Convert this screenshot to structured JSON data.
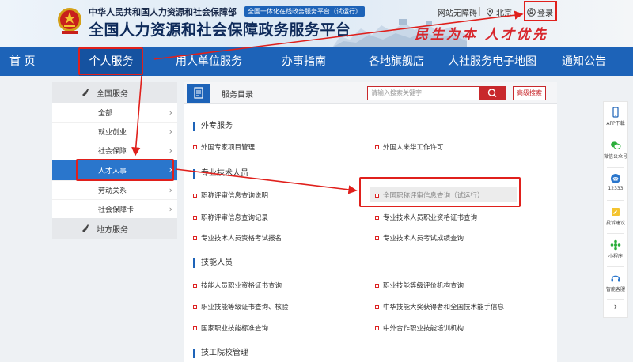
{
  "header": {
    "sub_title": "中华人民共和国人力资源和社会保障部",
    "badge": "全国一体化在线政务服务平台（试运行）",
    "main_title": "全国人力资源和社会保障政务服务平台",
    "slogan": "民生为本  人才优先",
    "accessibility": "网站无障碍",
    "location": "北京",
    "login": "登录"
  },
  "nav": {
    "items": [
      "首 页",
      "个人服务",
      "用人单位服务",
      "办事指南",
      "各地旗舰店",
      "人社服务电子地图",
      "通知公告"
    ],
    "active_index": 1
  },
  "sidebar": {
    "national_title": "全国服务",
    "items": [
      "全部",
      "就业创业",
      "社会保障",
      "人才人事",
      "劳动关系",
      "社会保障卡"
    ],
    "active_index": 3,
    "local_title": "地方服务"
  },
  "content": {
    "directory_label": "服务目录",
    "search_placeholder": "请输入搜索关键字",
    "advanced_search": "高级搜索",
    "sections": [
      {
        "title": "外专服务",
        "links": [
          "外国专家项目管理",
          "外国人来华工作许可"
        ]
      },
      {
        "title": "专业技术人员",
        "links": [
          "职称评审信息查询说明",
          "全国职称评审信息查询（试运行）",
          "职称评审信息查询记录",
          "专业技术人员职业资格证书查询",
          "专业技术人员资格考试报名",
          "专业技术人员考试成绩查询"
        ]
      },
      {
        "title": "技能人员",
        "links": [
          "技能人员职业资格证书查询",
          "职业技能等级评价机构查询",
          "职业技能等级证书查询、核验",
          "中华技能大奖获得者和全国技术能手信息",
          "国家职业技能标准查询",
          "中外合作职业技能培训机构"
        ]
      },
      {
        "title": "技工院校管理",
        "links": []
      }
    ]
  },
  "right_bar": [
    "APP下载",
    "微信公众号",
    "12333",
    "投诉建议",
    "小程序",
    "智能客服"
  ],
  "colors": {
    "primary": "#1d63b8",
    "highlight": "#e0201c",
    "active_nav": "#1552a0"
  }
}
